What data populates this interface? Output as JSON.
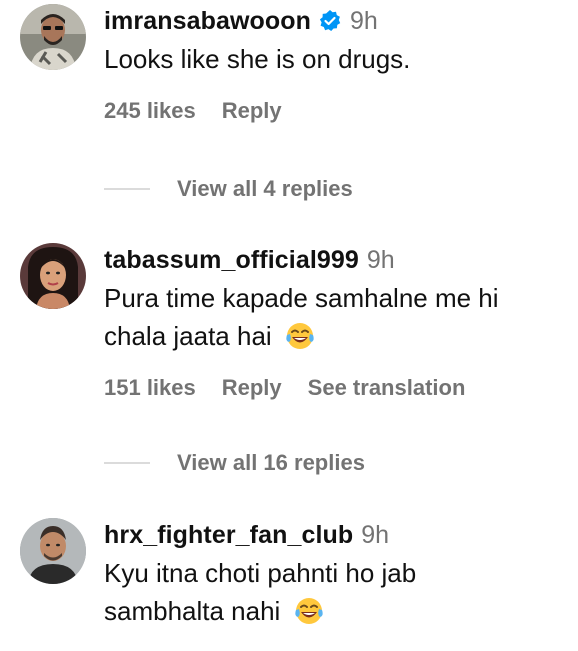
{
  "comments": [
    {
      "username": "imransabawooon",
      "verified": true,
      "time": "9h",
      "text": "Looks like she is on drugs.",
      "likes": "245 likes",
      "reply": "Reply",
      "view_replies": "View all 4 replies"
    },
    {
      "username": "tabassum_official999",
      "verified": false,
      "time": "9h",
      "text_line1": "Pura time kapade samhalne me hi",
      "text_line2": "chala jaata hai",
      "emoji": "laughing-tears-emoji",
      "likes": "151 likes",
      "reply": "Reply",
      "see_translation": "See translation",
      "view_replies": "View all 16 replies"
    },
    {
      "username": "hrx_fighter_fan_club",
      "verified": false,
      "time": "9h",
      "text_line1": "Kyu itna choti pahnti ho jab",
      "text_line2": "sambhalta nahi",
      "emoji": "laughing-tears-emoji"
    }
  ],
  "colors": {
    "text": "#111111",
    "muted": "#737373",
    "verified": "#0095f6",
    "divider": "#dbdbdb"
  }
}
